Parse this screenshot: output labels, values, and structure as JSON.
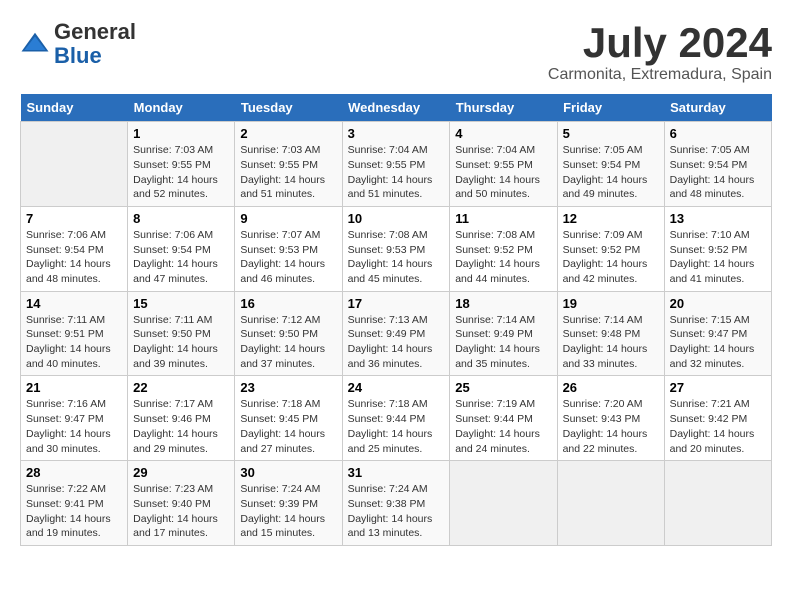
{
  "header": {
    "logo_line1": "General",
    "logo_line2": "Blue",
    "month_title": "July 2024",
    "subtitle": "Carmonita, Extremadura, Spain"
  },
  "weekdays": [
    "Sunday",
    "Monday",
    "Tuesday",
    "Wednesday",
    "Thursday",
    "Friday",
    "Saturday"
  ],
  "weeks": [
    [
      {
        "day": "",
        "empty": true
      },
      {
        "day": "1",
        "sunrise": "7:03 AM",
        "sunset": "9:55 PM",
        "daylight": "14 hours and 52 minutes."
      },
      {
        "day": "2",
        "sunrise": "7:03 AM",
        "sunset": "9:55 PM",
        "daylight": "14 hours and 51 minutes."
      },
      {
        "day": "3",
        "sunrise": "7:04 AM",
        "sunset": "9:55 PM",
        "daylight": "14 hours and 51 minutes."
      },
      {
        "day": "4",
        "sunrise": "7:04 AM",
        "sunset": "9:55 PM",
        "daylight": "14 hours and 50 minutes."
      },
      {
        "day": "5",
        "sunrise": "7:05 AM",
        "sunset": "9:54 PM",
        "daylight": "14 hours and 49 minutes."
      },
      {
        "day": "6",
        "sunrise": "7:05 AM",
        "sunset": "9:54 PM",
        "daylight": "14 hours and 48 minutes."
      }
    ],
    [
      {
        "day": "7",
        "sunrise": "7:06 AM",
        "sunset": "9:54 PM",
        "daylight": "14 hours and 48 minutes."
      },
      {
        "day": "8",
        "sunrise": "7:06 AM",
        "sunset": "9:54 PM",
        "daylight": "14 hours and 47 minutes."
      },
      {
        "day": "9",
        "sunrise": "7:07 AM",
        "sunset": "9:53 PM",
        "daylight": "14 hours and 46 minutes."
      },
      {
        "day": "10",
        "sunrise": "7:08 AM",
        "sunset": "9:53 PM",
        "daylight": "14 hours and 45 minutes."
      },
      {
        "day": "11",
        "sunrise": "7:08 AM",
        "sunset": "9:52 PM",
        "daylight": "14 hours and 44 minutes."
      },
      {
        "day": "12",
        "sunrise": "7:09 AM",
        "sunset": "9:52 PM",
        "daylight": "14 hours and 42 minutes."
      },
      {
        "day": "13",
        "sunrise": "7:10 AM",
        "sunset": "9:52 PM",
        "daylight": "14 hours and 41 minutes."
      }
    ],
    [
      {
        "day": "14",
        "sunrise": "7:11 AM",
        "sunset": "9:51 PM",
        "daylight": "14 hours and 40 minutes."
      },
      {
        "day": "15",
        "sunrise": "7:11 AM",
        "sunset": "9:50 PM",
        "daylight": "14 hours and 39 minutes."
      },
      {
        "day": "16",
        "sunrise": "7:12 AM",
        "sunset": "9:50 PM",
        "daylight": "14 hours and 37 minutes."
      },
      {
        "day": "17",
        "sunrise": "7:13 AM",
        "sunset": "9:49 PM",
        "daylight": "14 hours and 36 minutes."
      },
      {
        "day": "18",
        "sunrise": "7:14 AM",
        "sunset": "9:49 PM",
        "daylight": "14 hours and 35 minutes."
      },
      {
        "day": "19",
        "sunrise": "7:14 AM",
        "sunset": "9:48 PM",
        "daylight": "14 hours and 33 minutes."
      },
      {
        "day": "20",
        "sunrise": "7:15 AM",
        "sunset": "9:47 PM",
        "daylight": "14 hours and 32 minutes."
      }
    ],
    [
      {
        "day": "21",
        "sunrise": "7:16 AM",
        "sunset": "9:47 PM",
        "daylight": "14 hours and 30 minutes."
      },
      {
        "day": "22",
        "sunrise": "7:17 AM",
        "sunset": "9:46 PM",
        "daylight": "14 hours and 29 minutes."
      },
      {
        "day": "23",
        "sunrise": "7:18 AM",
        "sunset": "9:45 PM",
        "daylight": "14 hours and 27 minutes."
      },
      {
        "day": "24",
        "sunrise": "7:18 AM",
        "sunset": "9:44 PM",
        "daylight": "14 hours and 25 minutes."
      },
      {
        "day": "25",
        "sunrise": "7:19 AM",
        "sunset": "9:44 PM",
        "daylight": "14 hours and 24 minutes."
      },
      {
        "day": "26",
        "sunrise": "7:20 AM",
        "sunset": "9:43 PM",
        "daylight": "14 hours and 22 minutes."
      },
      {
        "day": "27",
        "sunrise": "7:21 AM",
        "sunset": "9:42 PM",
        "daylight": "14 hours and 20 minutes."
      }
    ],
    [
      {
        "day": "28",
        "sunrise": "7:22 AM",
        "sunset": "9:41 PM",
        "daylight": "14 hours and 19 minutes."
      },
      {
        "day": "29",
        "sunrise": "7:23 AM",
        "sunset": "9:40 PM",
        "daylight": "14 hours and 17 minutes."
      },
      {
        "day": "30",
        "sunrise": "7:24 AM",
        "sunset": "9:39 PM",
        "daylight": "14 hours and 15 minutes."
      },
      {
        "day": "31",
        "sunrise": "7:24 AM",
        "sunset": "9:38 PM",
        "daylight": "14 hours and 13 minutes."
      },
      {
        "day": "",
        "empty": true
      },
      {
        "day": "",
        "empty": true
      },
      {
        "day": "",
        "empty": true
      }
    ]
  ]
}
